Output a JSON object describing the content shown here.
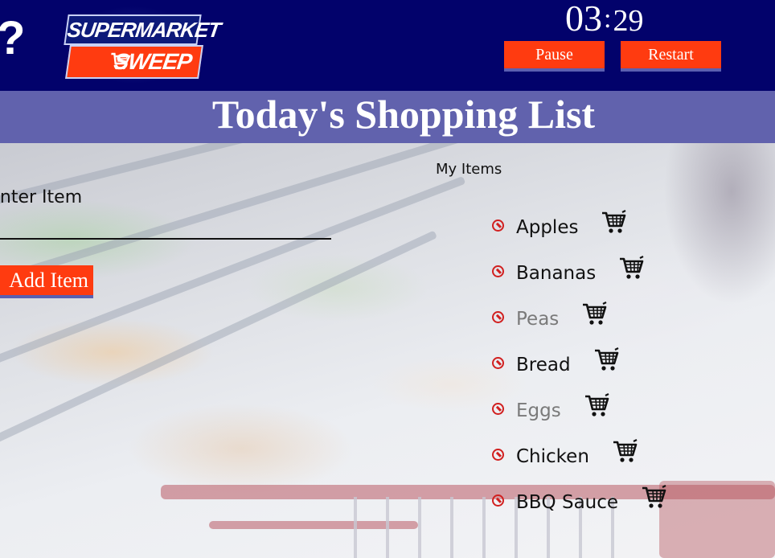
{
  "header": {
    "partial_glyph": "?",
    "logo_line1": "SUPERMARKET",
    "logo_line2": "SWEEP",
    "timer_minutes": "03",
    "timer_separator": ":",
    "timer_seconds": "29",
    "pause_label": "Pause",
    "restart_label": "Restart"
  },
  "title": "Today's Shopping List",
  "form": {
    "input_label": "Enter Item",
    "input_value": "",
    "add_button_label": "Add Item"
  },
  "list": {
    "heading": "My Items",
    "items": [
      {
        "name": "Apples",
        "got": false
      },
      {
        "name": "Bananas",
        "got": false
      },
      {
        "name": "Peas",
        "got": true
      },
      {
        "name": "Bread",
        "got": false
      },
      {
        "name": "Eggs",
        "got": true
      },
      {
        "name": "Chicken",
        "got": false
      },
      {
        "name": "BBQ Sauce",
        "got": false
      }
    ]
  },
  "icons": {
    "remove": "remove-icon",
    "cart": "cart-icon"
  },
  "colors": {
    "header_bg": "#02026b",
    "title_band": "#6162ad",
    "accent_button": "#ff3b10",
    "button_shadow": "#5b5fb0",
    "remove_icon": "#d11f1f",
    "got_item_text": "#7a7a7a"
  }
}
